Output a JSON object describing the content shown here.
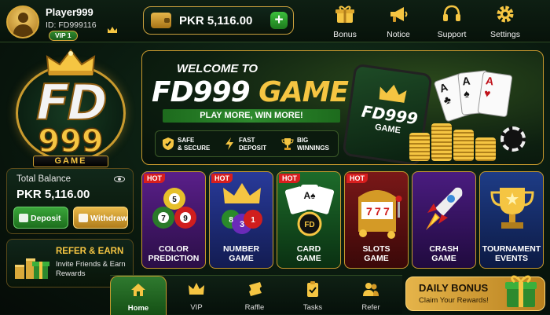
{
  "player": {
    "name": "Player999",
    "id": "ID: FD999116",
    "vip": "VIP 1"
  },
  "wallet": {
    "balance": "PKR 5,116.00",
    "add": "+"
  },
  "top_nav": [
    {
      "label": "Bonus",
      "icon": "gift-icon"
    },
    {
      "label": "Notice",
      "icon": "megaphone-icon"
    },
    {
      "label": "Support",
      "icon": "headset-icon"
    },
    {
      "label": "Settings",
      "icon": "gear-icon"
    }
  ],
  "logo": {
    "main": "FD",
    "number": "999",
    "word": "GAME"
  },
  "total_balance": {
    "label": "Total Balance",
    "amount": "PKR 5,116.00",
    "deposit": "Deposit",
    "withdraw": "Withdraw"
  },
  "refer": {
    "title": "REFER & EARN",
    "subtitle": "Invite Friends & Earn Rewards"
  },
  "banner": {
    "welcome": "WELCOME TO",
    "title_main": "FD999",
    "title_game": "GAME",
    "tagline": "PLAY MORE, WIN MORE!",
    "features": [
      {
        "line1": "SAFE",
        "line2": "& SECURE"
      },
      {
        "line1": "FAST",
        "line2": "DEPOSIT"
      },
      {
        "line1": "BIG",
        "line2": "WINNINGS"
      }
    ],
    "phone_logo": "FD999",
    "phone_game": "GAME",
    "carousel_dots": 5,
    "carousel_active": 1
  },
  "games": [
    {
      "line1": "COLOR",
      "line2": "PREDICTION",
      "hot": "HOT",
      "bg": "#3a1460"
    },
    {
      "line1": "NUMBER",
      "line2": "GAME",
      "hot": "HOT",
      "bg": "#1e2a72"
    },
    {
      "line1": "CARD",
      "line2": "GAME",
      "hot": "HOT",
      "bg": "#0f4a1c"
    },
    {
      "line1": "SLOTS",
      "line2": "GAME",
      "hot": "HOT",
      "bg": "#5a1010"
    },
    {
      "line1": "CRASH",
      "line2": "GAME",
      "hot": "",
      "bg": "#3a1664"
    },
    {
      "line1": "TOURNAMENT",
      "line2": "EVENTS",
      "hot": "",
      "bg": "#1a2a5e"
    }
  ],
  "bottom_nav": [
    {
      "label": "Home",
      "active": true
    },
    {
      "label": "VIP",
      "active": false
    },
    {
      "label": "Raffle",
      "active": false
    },
    {
      "label": "Tasks",
      "active": false
    },
    {
      "label": "Refer",
      "active": false
    }
  ],
  "daily_bonus": {
    "title": "DAILY BONUS",
    "subtitle": "Claim Your Rewards!"
  },
  "colors": {
    "gold": "#f5c542",
    "green": "#2e8a2e",
    "hot": "#d81e1e"
  }
}
